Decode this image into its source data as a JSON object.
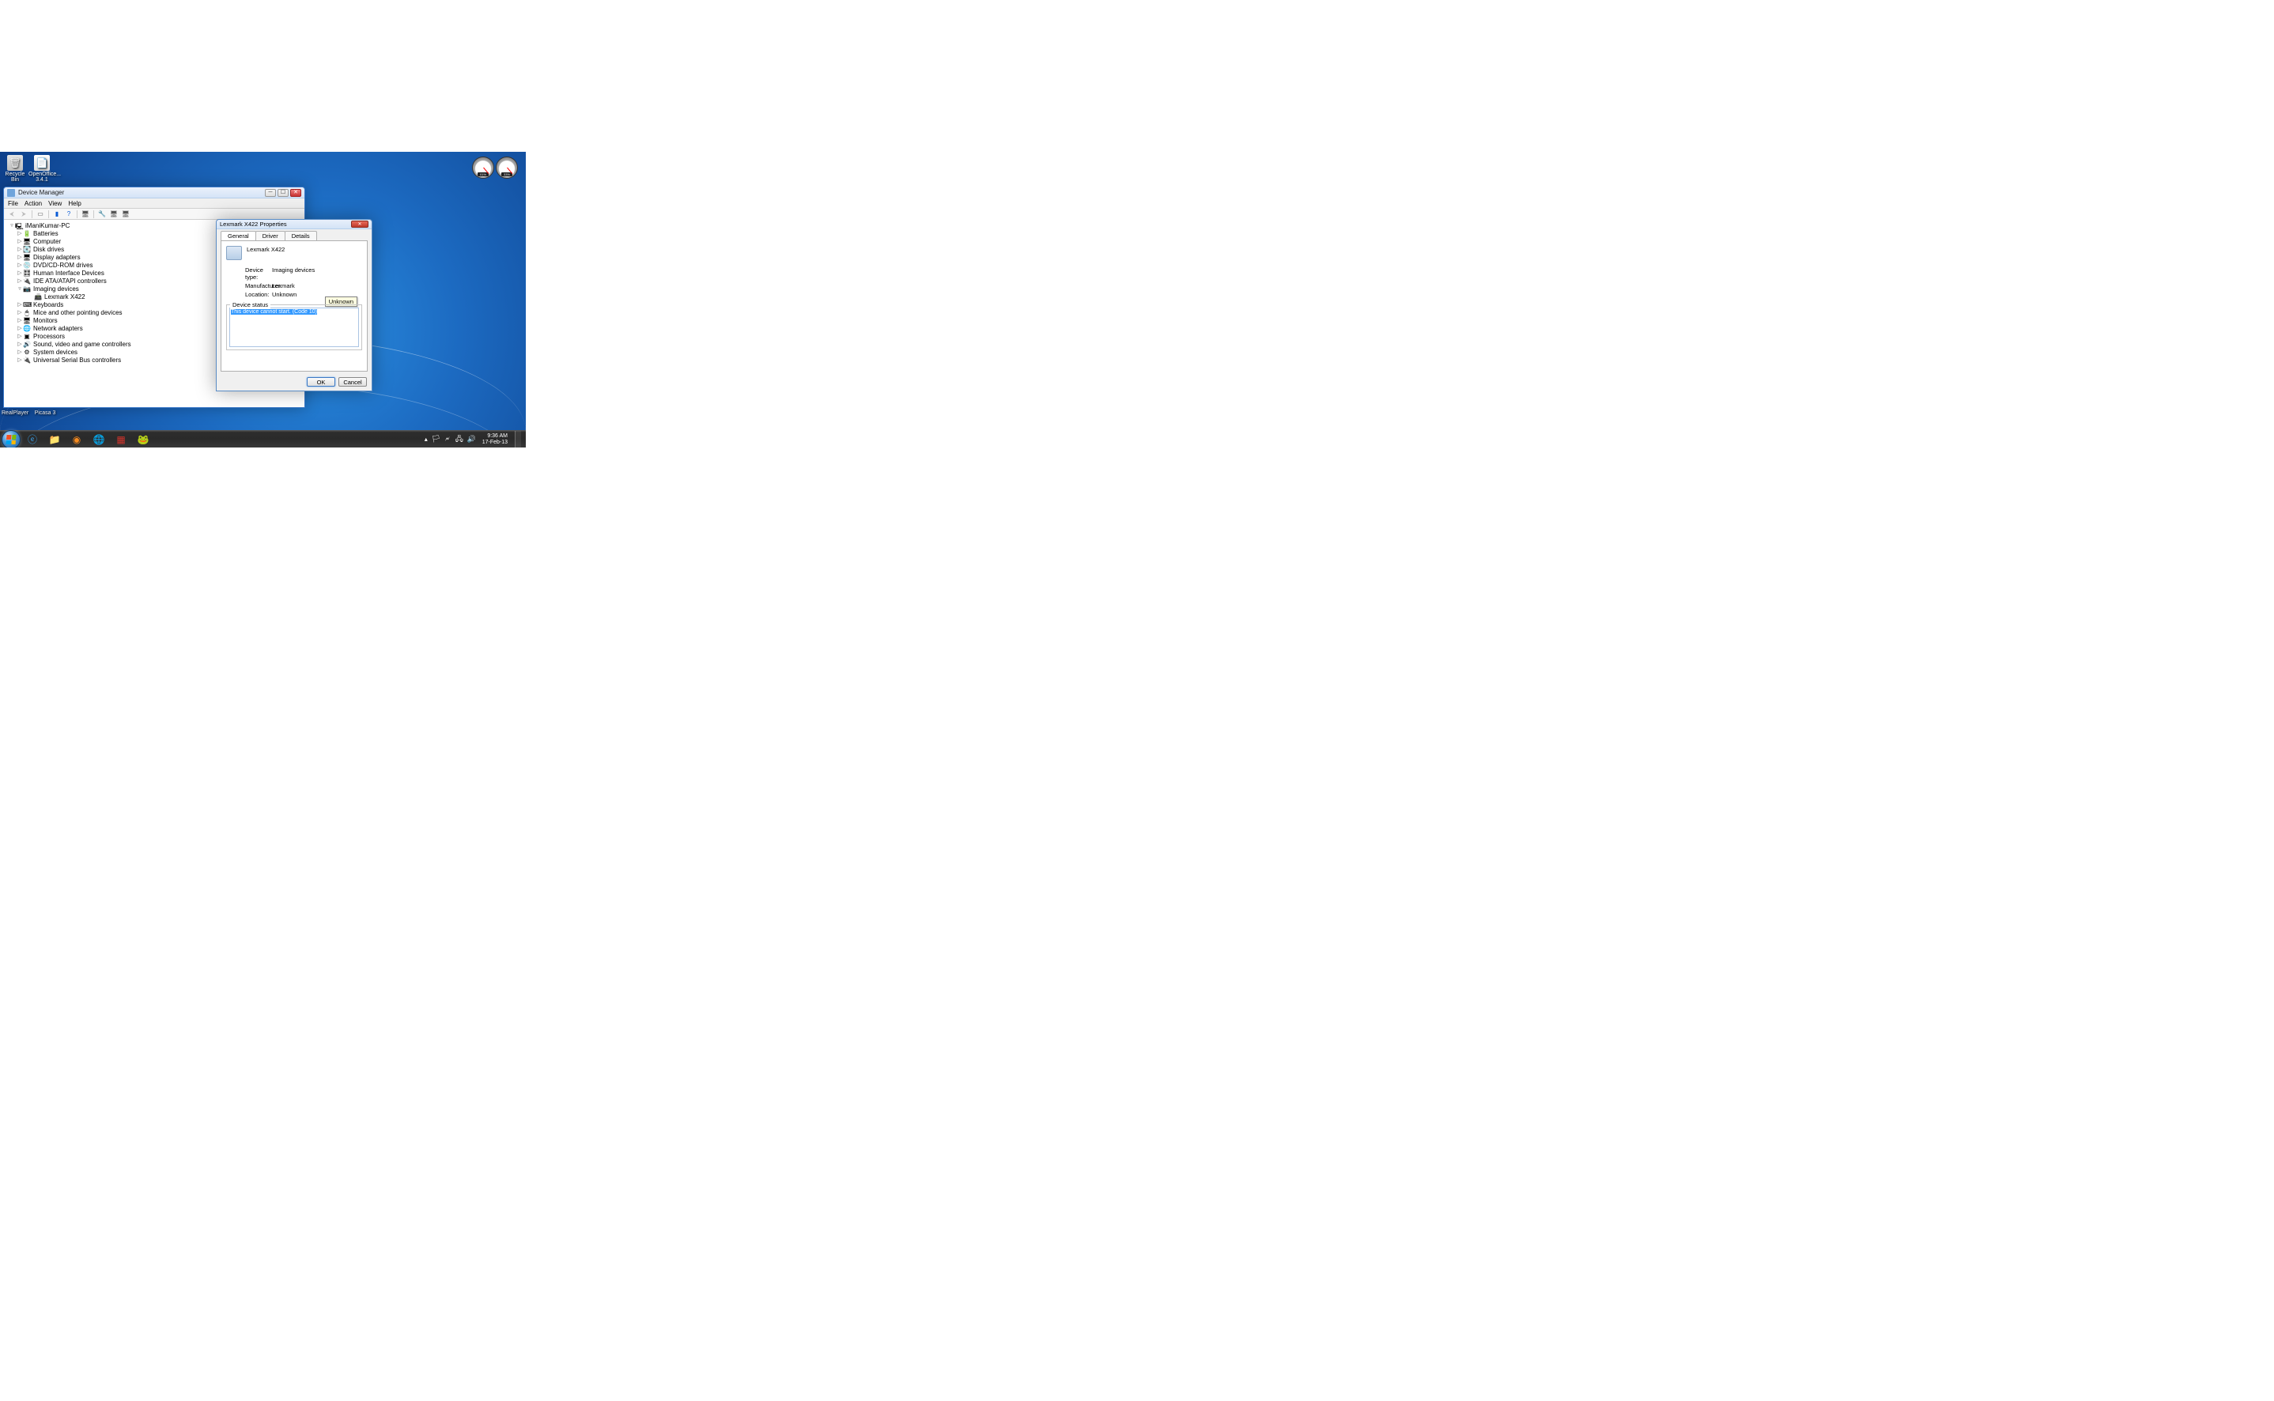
{
  "desktop_icons": {
    "recycle_bin": "Recycle Bin",
    "openoffice": "OpenOffice... 3.4.1",
    "realplayer": "RealPlayer",
    "picasa": "Picasa 3"
  },
  "gadget": {
    "cpu_label": "01%",
    "ram_label": "33%"
  },
  "devmgr": {
    "title": "Device Manager",
    "menus": [
      "File",
      "Action",
      "View",
      "Help"
    ],
    "tree_root": "iManiKumar-PC",
    "categories": [
      {
        "label": "Batteries",
        "icon": "🔋",
        "arrow": "▷"
      },
      {
        "label": "Computer",
        "icon": "🖥",
        "arrow": "▷"
      },
      {
        "label": "Disk drives",
        "icon": "💽",
        "arrow": "▷"
      },
      {
        "label": "Display adapters",
        "icon": "🖥",
        "arrow": "▷"
      },
      {
        "label": "DVD/CD-ROM drives",
        "icon": "💿",
        "arrow": "▷"
      },
      {
        "label": "Human Interface Devices",
        "icon": "🎛",
        "arrow": "▷"
      },
      {
        "label": "IDE ATA/ATAPI controllers",
        "icon": "🔌",
        "arrow": "▷"
      },
      {
        "label": "Imaging devices",
        "icon": "📷",
        "arrow": "▿",
        "children": [
          {
            "label": "Lexmark X422",
            "icon": "📠"
          }
        ]
      },
      {
        "label": "Keyboards",
        "icon": "⌨",
        "arrow": "▷"
      },
      {
        "label": "Mice and other pointing devices",
        "icon": "🖱",
        "arrow": "▷"
      },
      {
        "label": "Monitors",
        "icon": "🖥",
        "arrow": "▷"
      },
      {
        "label": "Network adapters",
        "icon": "🌐",
        "arrow": "▷"
      },
      {
        "label": "Processors",
        "icon": "▣",
        "arrow": "▷"
      },
      {
        "label": "Sound, video and game controllers",
        "icon": "🔊",
        "arrow": "▷"
      },
      {
        "label": "System devices",
        "icon": "⚙",
        "arrow": "▷"
      },
      {
        "label": "Universal Serial Bus controllers",
        "icon": "🔌",
        "arrow": "▷"
      }
    ]
  },
  "props": {
    "title": "Lexmark X422 Properties",
    "tabs": [
      "General",
      "Driver",
      "Details"
    ],
    "device_name": "Lexmark X422",
    "rows": {
      "device_type_label": "Device type:",
      "device_type_value": "Imaging devices",
      "manufacturer_label": "Manufacturer:",
      "manufacturer_value": "Lexmark",
      "location_label": "Location:",
      "location_value": "Unknown"
    },
    "tooltip": "Unknown",
    "status_legend": "Device status",
    "status_text": "This device cannot start. (Code 10)",
    "ok": "OK",
    "cancel": "Cancel"
  },
  "taskbar": {
    "time": "9:36 AM",
    "date": "17-Feb-13"
  }
}
